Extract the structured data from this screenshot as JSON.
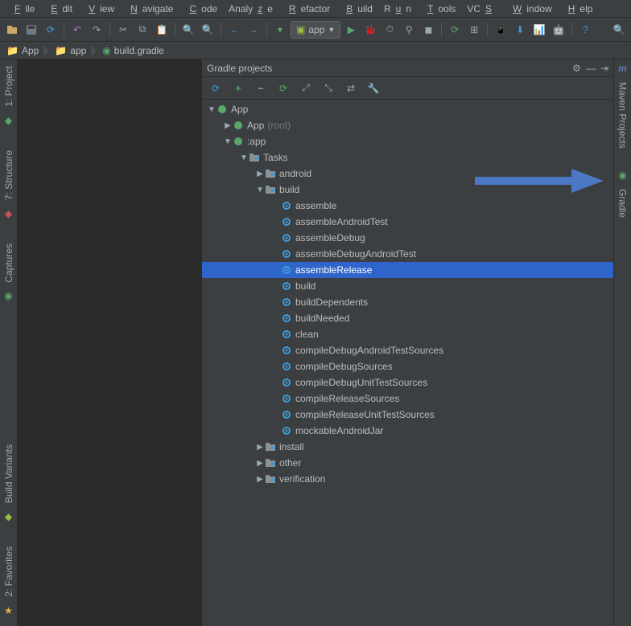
{
  "menu": {
    "items": [
      "File",
      "Edit",
      "View",
      "Navigate",
      "Code",
      "Analyze",
      "Refactor",
      "Build",
      "Run",
      "Tools",
      "VCS",
      "Window",
      "Help"
    ]
  },
  "toolbar": {
    "run_config": "app"
  },
  "breadcrumbs": {
    "items": [
      "App",
      "app",
      "build.gradle"
    ]
  },
  "left_tool_windows": {
    "project": "1: Project",
    "structure": "7: Structure",
    "captures": "Captures",
    "build_variants": "Build Variants",
    "favorites": "2: Favorites"
  },
  "right_tool_windows": {
    "maven": "Maven Projects",
    "gradle": "Gradle"
  },
  "gradle_pane": {
    "title": "Gradle projects"
  },
  "tree": {
    "root": "App",
    "root_child": "App",
    "root_child_suffix": "(root)",
    "app_module": ":app",
    "tasks": "Tasks",
    "task_groups": {
      "android": "android",
      "build": "build",
      "install": "install",
      "other": "other",
      "verification": "verification"
    },
    "build_tasks": [
      "assemble",
      "assembleAndroidTest",
      "assembleDebug",
      "assembleDebugAndroidTest",
      "assembleRelease",
      "build",
      "buildDependents",
      "buildNeeded",
      "clean",
      "compileDebugAndroidTestSources",
      "compileDebugSources",
      "compileDebugUnitTestSources",
      "compileReleaseSources",
      "compileReleaseUnitTestSources",
      "mockableAndroidJar"
    ],
    "selected_task": "assembleRelease"
  }
}
